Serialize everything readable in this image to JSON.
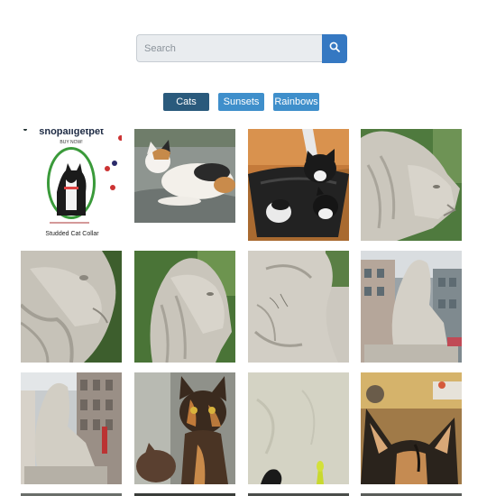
{
  "search": {
    "placeholder": "Search",
    "icon": "search-icon"
  },
  "filters": [
    {
      "label": "Cats",
      "active": true
    },
    {
      "label": "Sunsets",
      "active": false
    },
    {
      "label": "Rainbows",
      "active": false
    }
  ],
  "colors": {
    "active_filter": "#2a5a7c",
    "filter": "#3f8fcb",
    "search_button": "#3578c2"
  },
  "ad": {
    "brand": "shopallgetpet",
    "cta": "BUY NOW!",
    "caption": "Studded Cat Collar"
  },
  "gallery": [
    {
      "subject": "cat-collar-ad"
    },
    {
      "subject": "calico-cat-lying"
    },
    {
      "subject": "cats-in-basket"
    },
    {
      "subject": "lion-statue-head"
    },
    {
      "subject": "lion-statue-closeup"
    },
    {
      "subject": "lion-statue-side"
    },
    {
      "subject": "lion-statue-carved"
    },
    {
      "subject": "lion-statue-street"
    },
    {
      "subject": "lion-statue-building"
    },
    {
      "subject": "tortoiseshell-kitten"
    },
    {
      "subject": "cat-paw-toy"
    },
    {
      "subject": "calico-cat-ears"
    }
  ]
}
